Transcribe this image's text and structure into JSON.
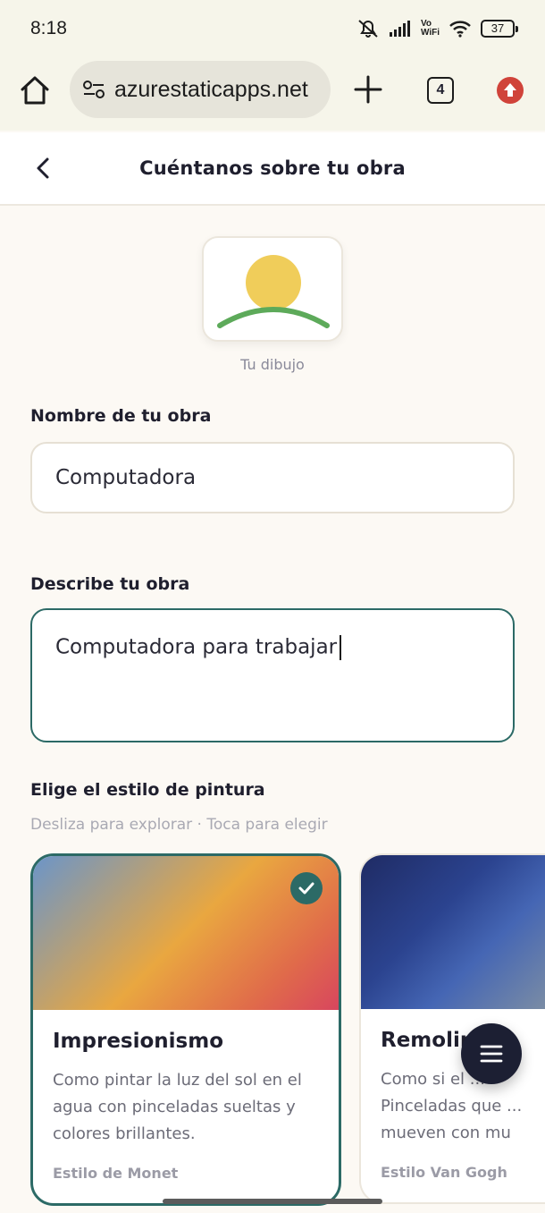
{
  "status_bar": {
    "time": "8:18",
    "network_label_top": "Vo",
    "network_label_bottom": "WiFi",
    "battery": "37"
  },
  "browser": {
    "url": "azurestaticapps.net",
    "tab_count": "4",
    "icons": [
      "home-icon",
      "site-settings-icon",
      "plus-icon",
      "tab-switcher-icon",
      "update-icon"
    ]
  },
  "header": {
    "title": "Cuéntanos sobre tu obra"
  },
  "drawing": {
    "caption": "Tu dibujo",
    "sun_color": "#f0cd5a",
    "ground_color": "#5daa5a"
  },
  "form": {
    "name_label": "Nombre de tu obra",
    "name_value": "Computadora",
    "description_label": "Describe tu obra",
    "description_value": "Computadora para trabajar"
  },
  "styles": {
    "title": "Elige el estilo de pintura",
    "hint": "Desliza para explorar · Toca para elegir",
    "cards": [
      {
        "title": "Impresionismo",
        "description": "Como pintar la luz del sol en el agua con pinceladas sueltas y colores brillantes.",
        "footer": "Estilo de Monet",
        "selected": true
      },
      {
        "title": "Remolin",
        "description": "Como si el ... Pinceladas que ... mueven con mu",
        "footer": "Estilo Van Gogh",
        "selected": false
      }
    ]
  },
  "colors": {
    "accent": "#2c6a66",
    "background": "#fcf9f4",
    "fab": "#1c1f33"
  }
}
